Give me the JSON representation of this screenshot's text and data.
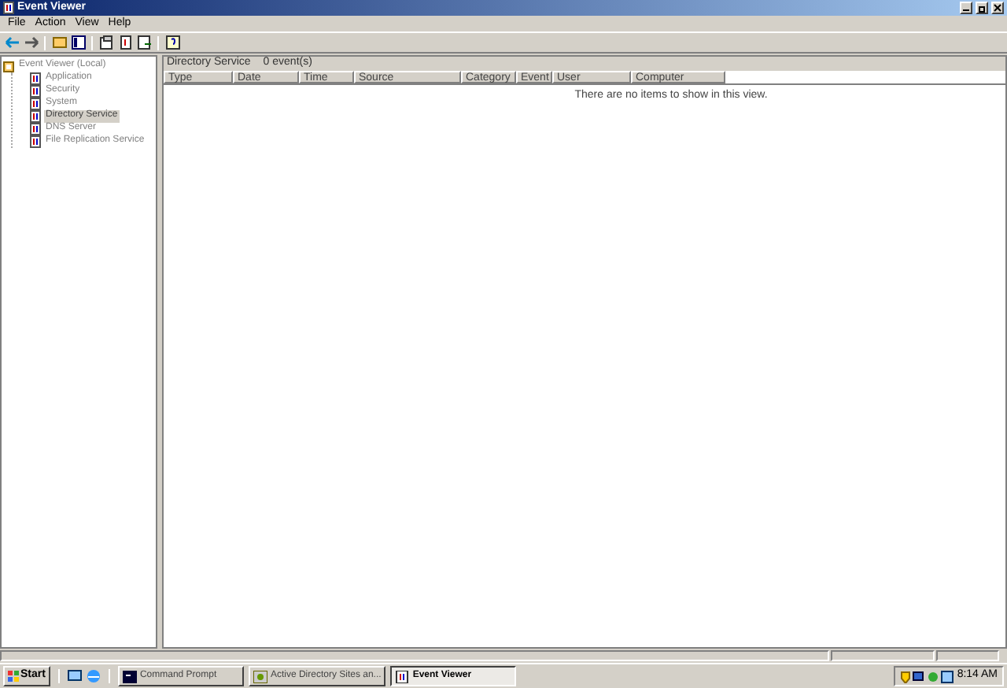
{
  "window": {
    "title": "Event Viewer"
  },
  "menu": [
    "File",
    "Action",
    "View",
    "Help"
  ],
  "tree": {
    "label": "Event Viewer (Local)",
    "children": [
      {
        "label": "Application",
        "selected": false
      },
      {
        "label": "Security",
        "selected": false
      },
      {
        "label": "System",
        "selected": false
      },
      {
        "label": "Directory Service",
        "selected": true
      },
      {
        "label": "DNS Server",
        "selected": false
      },
      {
        "label": "File Replication Service",
        "selected": false
      }
    ]
  },
  "list_header": {
    "title": "Directory Service",
    "count": "0 event(s)"
  },
  "table": {
    "columns": [
      "Type",
      "Date",
      "Time",
      "Source",
      "Category",
      "Event",
      "User",
      "Computer"
    ],
    "empty_message": "There are no items to show in this view."
  },
  "taskbar": {
    "start": "Start",
    "tasks": [
      {
        "label": "Command Prompt",
        "selected": false,
        "kind": "console"
      },
      {
        "label": "Active Directory Sites an...",
        "selected": false,
        "kind": "sites"
      },
      {
        "label": "Event Viewer",
        "selected": true,
        "kind": "log"
      }
    ],
    "clock": "8:14 AM"
  }
}
